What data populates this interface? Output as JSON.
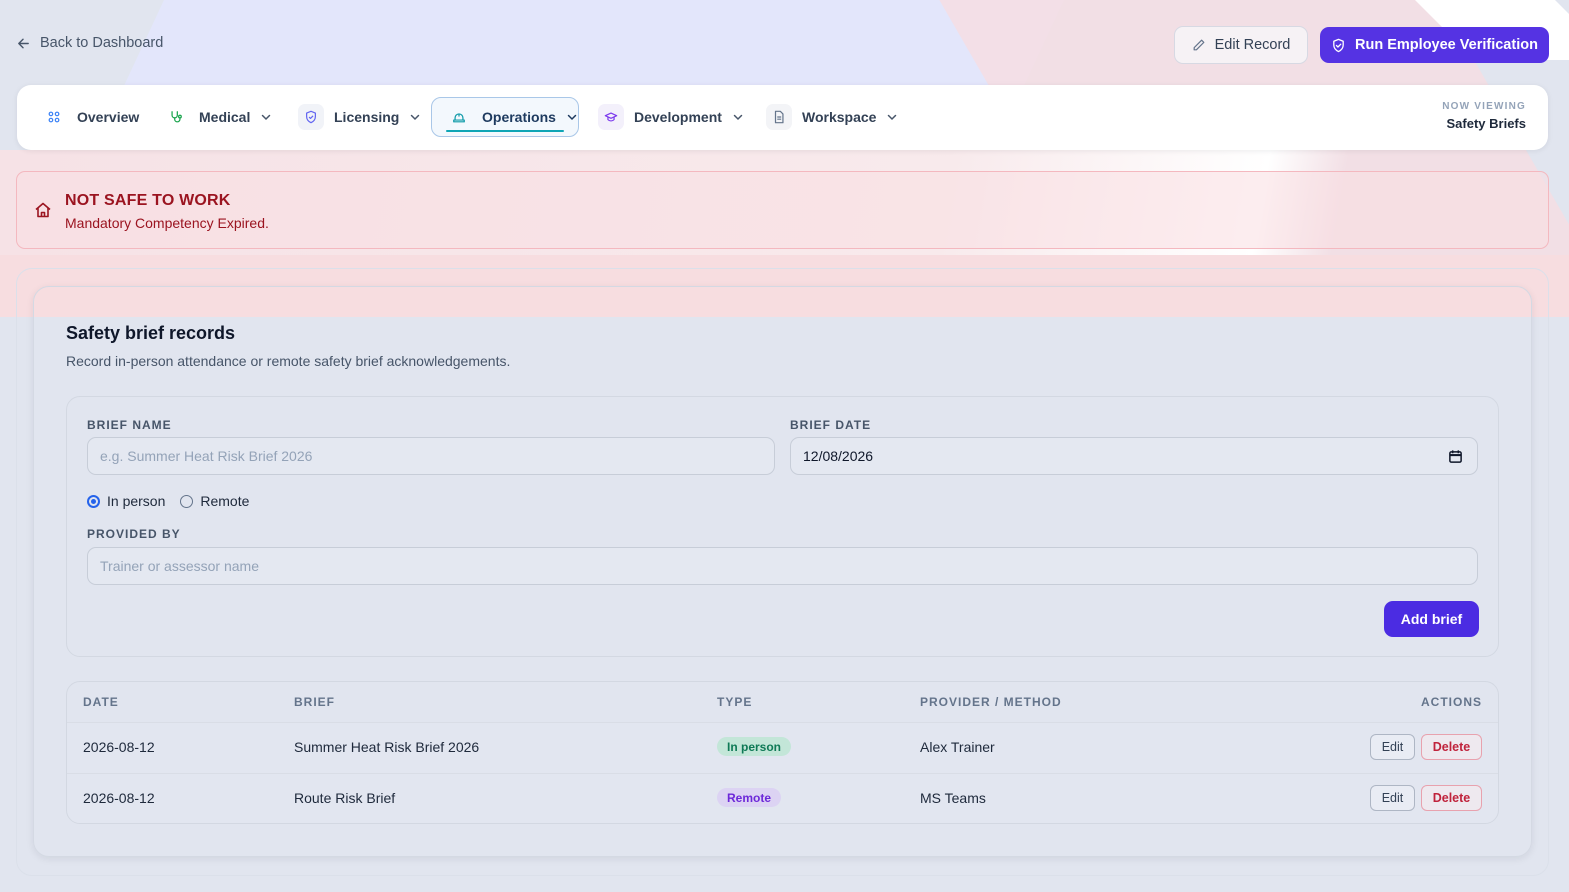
{
  "header": {
    "back_label": "Back to Dashboard",
    "edit_label": "Edit Record",
    "run_label": "Run Employee Verification"
  },
  "nav": {
    "tabs": [
      {
        "label": "Overview",
        "icon": "grid-icon"
      },
      {
        "label": "Medical",
        "icon": "stethoscope-icon"
      },
      {
        "label": "Licensing",
        "icon": "shield-icon"
      },
      {
        "label": "Operations",
        "icon": "hard-hat-icon",
        "active": true
      },
      {
        "label": "Development",
        "icon": "graduation-cap-icon"
      },
      {
        "label": "Workspace",
        "icon": "document-icon"
      }
    ],
    "now_viewing_label": "NOW VIEWING",
    "now_viewing_value": "Safety Briefs"
  },
  "alert": {
    "title": "NOT SAFE TO WORK",
    "detail": "Mandatory Competency Expired."
  },
  "card": {
    "title": "Safety brief records",
    "subtitle": "Record in-person attendance or remote safety brief acknowledgements."
  },
  "form": {
    "brief_name_label": "BRIEF NAME",
    "brief_name_placeholder": "e.g. Summer Heat Risk Brief 2026",
    "brief_date_label": "BRIEF DATE",
    "brief_date_value": "12/08/2026",
    "radio_in_person": "In person",
    "radio_remote": "Remote",
    "provided_by_label": "PROVIDED BY",
    "provided_by_placeholder": "Trainer or assessor name",
    "add_label": "Add brief"
  },
  "table": {
    "headers": [
      "DATE",
      "BRIEF",
      "TYPE",
      "PROVIDER / METHOD",
      "ACTIONS"
    ],
    "rows": [
      {
        "date": "2026-08-12",
        "brief": "Summer Heat Risk Brief 2026",
        "type": "In person",
        "provider": "Alex Trainer"
      },
      {
        "date": "2026-08-12",
        "brief": "Route Risk Brief",
        "type": "Remote",
        "provider": "MS Teams"
      }
    ],
    "edit_label": "Edit",
    "delete_label": "Delete"
  },
  "colors": {
    "primary": "#5533e3",
    "danger": "#9b1420",
    "in_person_badge": "#c3e6d8",
    "remote_badge": "#dcd3f3"
  }
}
